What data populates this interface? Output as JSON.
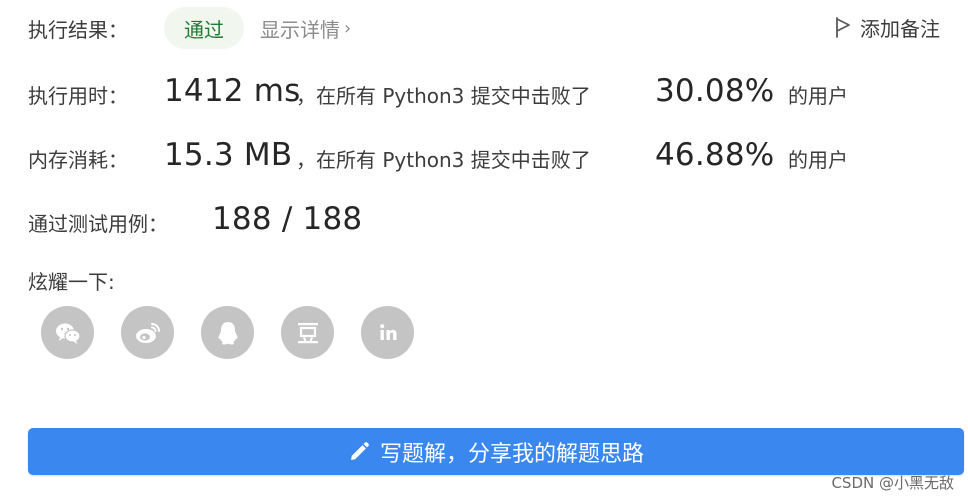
{
  "result": {
    "label": "执行结果：",
    "status": "通过",
    "details_link": "显示详情",
    "details_chevron": "›",
    "add_note": "添加备注"
  },
  "runtime": {
    "label": "执行用时：",
    "value": "1412 ms",
    "mid_text": "，在所有 Python3 提交中击败了",
    "percent": "30.08%",
    "suffix": "的用户"
  },
  "memory": {
    "label": "内存消耗：",
    "value": "15.3 MB",
    "mid_text": "，在所有 Python3 提交中击败了",
    "percent": "46.88%",
    "suffix": "的用户"
  },
  "testcases": {
    "label": "通过测试用例：",
    "value": "188 / 188"
  },
  "share": {
    "label": "炫耀一下:",
    "icons": [
      "wechat-icon",
      "weibo-icon",
      "qq-icon",
      "douban-icon",
      "linkedin-icon"
    ]
  },
  "write_solution": {
    "label": "写题解，分享我的解题思路",
    "icon": "pencil-icon"
  },
  "watermark": "CSDN @小黑无敌",
  "colors": {
    "accent": "#3a87f0",
    "success_text": "#1f7a33",
    "success_bg": "#f1f7ef",
    "icon_gray": "#c4c4c4"
  }
}
